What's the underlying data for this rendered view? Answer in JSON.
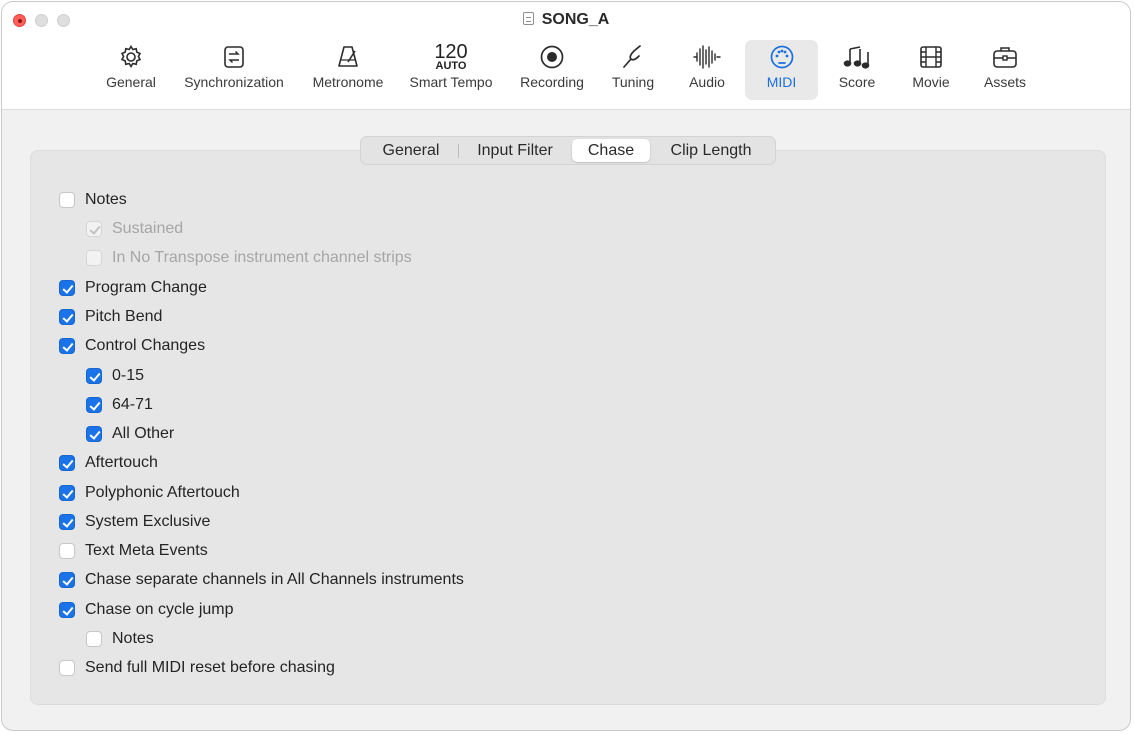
{
  "window": {
    "title": "SONG_A",
    "doc_icon": "document-icon"
  },
  "toolbar": {
    "items": [
      {
        "label": "General",
        "icon": "gear-icon"
      },
      {
        "label": "Synchronization",
        "icon": "sync-icon"
      },
      {
        "label": "Metronome",
        "icon": "metronome-icon"
      },
      {
        "label": "Smart Tempo",
        "icon": "tempo-icon",
        "tempo_value": "120",
        "tempo_mode": "AUTO"
      },
      {
        "label": "Recording",
        "icon": "record-icon"
      },
      {
        "label": "Tuning",
        "icon": "tuning-fork-icon"
      },
      {
        "label": "Audio",
        "icon": "waveform-icon"
      },
      {
        "label": "MIDI",
        "icon": "midi-connector-icon",
        "active": true
      },
      {
        "label": "Score",
        "icon": "music-notes-icon"
      },
      {
        "label": "Movie",
        "icon": "film-icon"
      },
      {
        "label": "Assets",
        "icon": "briefcase-icon"
      }
    ]
  },
  "tabs": {
    "items": [
      {
        "label": "General"
      },
      {
        "label": "Input Filter"
      },
      {
        "label": "Chase",
        "selected": true
      },
      {
        "label": "Clip Length"
      }
    ]
  },
  "options": [
    {
      "label": "Notes",
      "checked": false,
      "enabled": true
    },
    {
      "label": "Sustained",
      "checked": true,
      "enabled": false
    },
    {
      "label": "In No Transpose instrument channel strips",
      "checked": false,
      "enabled": false
    },
    {
      "label": "Program Change",
      "checked": true,
      "enabled": true
    },
    {
      "label": "Pitch Bend",
      "checked": true,
      "enabled": true
    },
    {
      "label": "Control Changes",
      "checked": true,
      "enabled": true
    },
    {
      "label": "0-15",
      "checked": true,
      "enabled": true
    },
    {
      "label": "64-71",
      "checked": true,
      "enabled": true
    },
    {
      "label": "All Other",
      "checked": true,
      "enabled": true
    },
    {
      "label": "Aftertouch",
      "checked": true,
      "enabled": true
    },
    {
      "label": "Polyphonic Aftertouch",
      "checked": true,
      "enabled": true
    },
    {
      "label": "System Exclusive",
      "checked": true,
      "enabled": true
    },
    {
      "label": "Text Meta Events",
      "checked": false,
      "enabled": true
    },
    {
      "label": "Chase separate channels in All Channels instruments",
      "checked": true,
      "enabled": true
    },
    {
      "label": "Chase on cycle jump",
      "checked": true,
      "enabled": true
    },
    {
      "label": "Notes",
      "checked": false,
      "enabled": true
    },
    {
      "label": "Send full MIDI reset before chasing",
      "checked": false,
      "enabled": true
    }
  ],
  "colors": {
    "accent": "#1a73e8",
    "active_label": "#1a6fe0",
    "close_button": "#ff5f57"
  }
}
